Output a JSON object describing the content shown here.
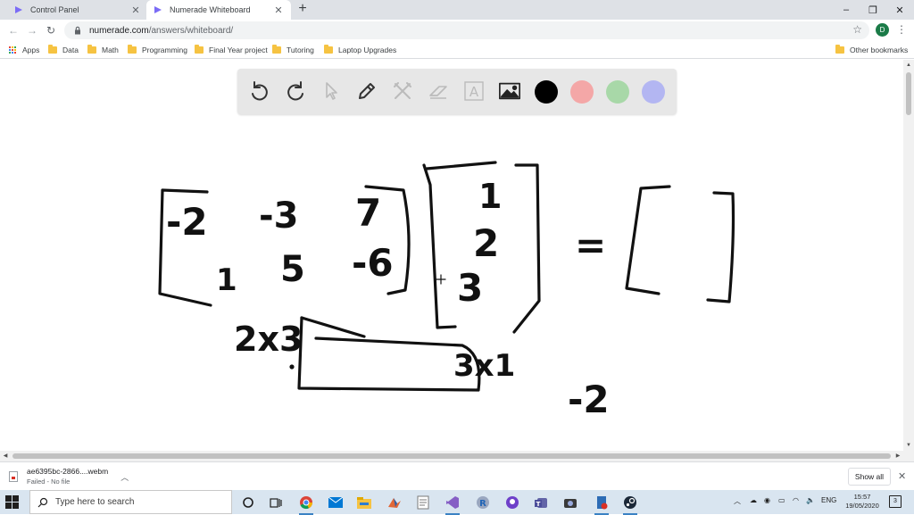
{
  "browser": {
    "tabs": [
      {
        "label": "Control Panel",
        "active": false
      },
      {
        "label": "Numerade Whiteboard",
        "active": true
      }
    ],
    "url_host": "numerade.com",
    "url_path": "/answers/whiteboard/",
    "profile_initial": "D",
    "window_controls": {
      "minimize": "–",
      "maximize": "❐",
      "close": "✕"
    },
    "accent_color": "#7b6cf6"
  },
  "bookmarks": {
    "apps": "Apps",
    "items": [
      "Data",
      "Math",
      "Programming",
      "Final Year project",
      "Tutoring",
      "Laptop Upgrades"
    ],
    "other": "Other bookmarks"
  },
  "whiteboard": {
    "tools": [
      "undo-icon",
      "redo-icon",
      "pointer-icon",
      "pen-icon",
      "tools-icon",
      "eraser-icon",
      "text-icon",
      "image-icon"
    ],
    "text_tool_glyph": "A",
    "swatches": [
      "#000000",
      "#f4a7a7",
      "#a8d8a8",
      "#b3b6f2"
    ],
    "handwriting": {
      "matrix_a": [
        "-2",
        "-3",
        "7",
        "1",
        "5",
        "-6"
      ],
      "vector_b": [
        "1",
        "2",
        "3"
      ],
      "equals": "=",
      "dims_a": "2x3",
      "dims_b": "3x1",
      "scratch": "-2"
    }
  },
  "downloads": {
    "filename": "ae6395bc-2866....webm",
    "status": "Failed - No file",
    "show_all": "Show all"
  },
  "taskbar": {
    "search_placeholder": "Type here to search",
    "language": "ENG",
    "time": "15:57",
    "date": "19/05/2020",
    "notifications": "3"
  }
}
